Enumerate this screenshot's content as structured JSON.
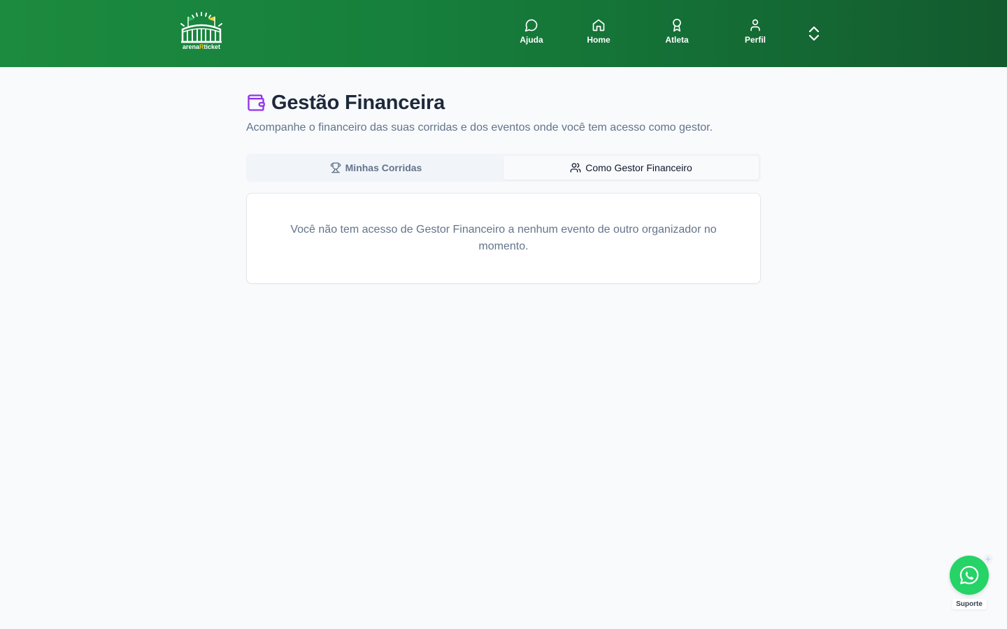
{
  "brand": {
    "logo_text_prefix": "arena",
    "logo_text_highlight": "R",
    "logo_text_suffix": "ticket"
  },
  "nav": {
    "items": [
      {
        "label": "Ajuda",
        "icon": "message-circle-icon"
      },
      {
        "label": "Home",
        "icon": "home-icon"
      },
      {
        "label": "Atleta",
        "icon": "award-icon"
      },
      {
        "label": "Perfil",
        "icon": "user-icon"
      }
    ],
    "toggle_icon": "chevrons-up-down-icon"
  },
  "page": {
    "title": "Gestão Financeira",
    "title_icon": "wallet-icon",
    "subtitle": "Acompanhe o financeiro das suas corridas e dos eventos onde você tem acesso como gestor."
  },
  "tabs": [
    {
      "label": "Minhas Corridas",
      "icon": "trophy-icon",
      "active": false
    },
    {
      "label": "Como Gestor Financeiro",
      "icon": "users-icon",
      "active": true
    }
  ],
  "empty_state": {
    "message": "Você não tem acesso de Gestor Financeiro a nenhum evento de outro organizador no momento."
  },
  "support": {
    "label": "Suporte",
    "icon": "whatsapp-icon"
  },
  "colors": {
    "header_start": "#1c8a3f",
    "header_end": "#135a2e",
    "accent_purple": "#9333ea",
    "whatsapp_green": "#25d366",
    "background": "#f8fafc"
  }
}
